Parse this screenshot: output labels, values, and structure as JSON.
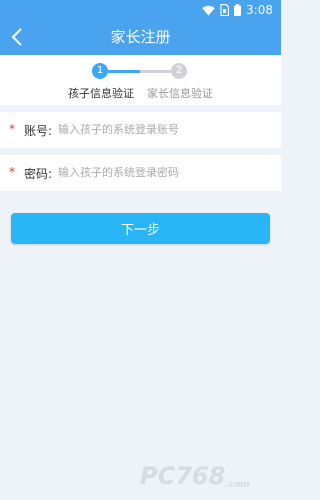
{
  "status_bar": {
    "time": "3:08",
    "icons": [
      "wifi-icon",
      "sim-icon",
      "battery-icon"
    ]
  },
  "app_bar": {
    "title": "家长注册",
    "back_icon": "chevron-left-icon"
  },
  "steps": [
    {
      "number": "1",
      "label": "孩子信息验证",
      "active": true
    },
    {
      "number": "2",
      "label": "家长信息验证",
      "active": false
    }
  ],
  "form": {
    "account": {
      "required_mark": "*",
      "label": "账号:",
      "placeholder": "输入孩子的系统登录账号",
      "value": ""
    },
    "password": {
      "required_mark": "*",
      "label": "密码:",
      "placeholder": "输入孩子的系统登录密码",
      "value": ""
    }
  },
  "next_button": {
    "label": "下一步"
  },
  "watermark": {
    "main": "PC768",
    "sub": ".com"
  },
  "colors": {
    "header": "#4aa3ee",
    "accent": "#3aa8f2",
    "button": "#29b6f6",
    "required": "#e53935",
    "background": "#eef2f9"
  }
}
